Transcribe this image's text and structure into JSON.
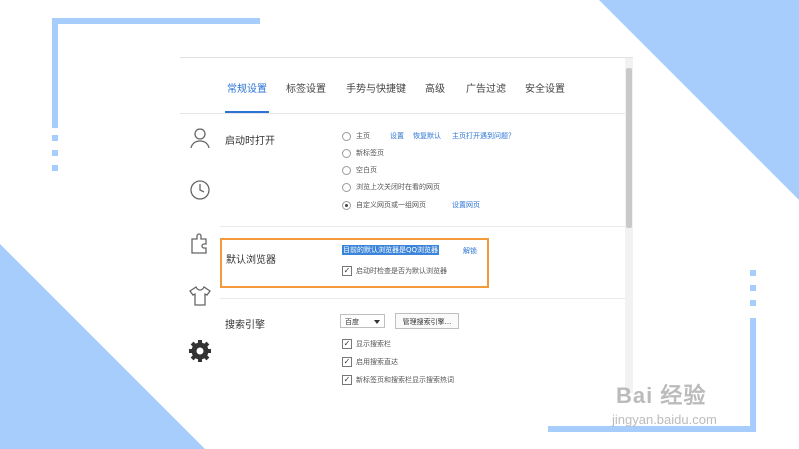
{
  "tabs": [
    "常规设置",
    "标签设置",
    "手势与快捷键",
    "高级",
    "广告过滤",
    "安全设置"
  ],
  "startup": {
    "title": "启动时打开",
    "options": [
      "主页",
      "新标签页",
      "空白页",
      "浏览上次关闭时在看的网页",
      "自定义网页或一组网页"
    ],
    "selected_index": 4,
    "home_links": [
      "设置",
      "恢复默认",
      "主页打开遇到问题？"
    ],
    "custom_link": "设置网页"
  },
  "default_browser": {
    "title": "默认浏览器",
    "status": "目前的默认浏览器是QQ浏览器",
    "unbind": "解锁",
    "check_label": "启动时检查是否为默认浏览器",
    "checked": true
  },
  "search": {
    "title": "搜索引擎",
    "engine": "百度",
    "manage_button": "管理搜索引擎...",
    "checks": [
      "显示搜索栏",
      "启用搜索直达",
      "新标签页和搜索栏显示搜索热词"
    ]
  },
  "icons": [
    "user-icon",
    "clock-icon",
    "puzzle-icon",
    "shirt-icon",
    "gear-icon"
  ],
  "watermark": {
    "logo": "Bai 经验",
    "url": "jingyan.baidu.com"
  },
  "colors": {
    "accent": "#2b74d6",
    "highlight_border": "#f39a3c",
    "decor": "#a6cdfb"
  }
}
